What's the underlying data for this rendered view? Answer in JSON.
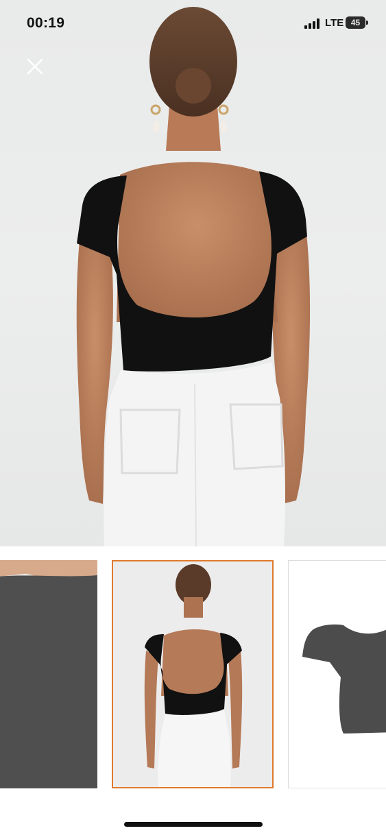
{
  "status_bar": {
    "time": "00:19",
    "network": "LTE",
    "battery_level": "45",
    "signal_icon": "cellular-signal-icon",
    "battery_icon": "battery-icon"
  },
  "viewer": {
    "close_icon": "close-icon",
    "main_image_icon": "product-photo-backless-black-top",
    "thumbnails": [
      {
        "icon": "fabric-closeup-photo",
        "selected": false
      },
      {
        "icon": "model-back-view-photo",
        "selected": true
      },
      {
        "icon": "product-flatlay-photo",
        "selected": false
      }
    ]
  },
  "colors": {
    "selected_border": "#e07a2c",
    "garment": "#111111",
    "background": "#e9eaea"
  }
}
